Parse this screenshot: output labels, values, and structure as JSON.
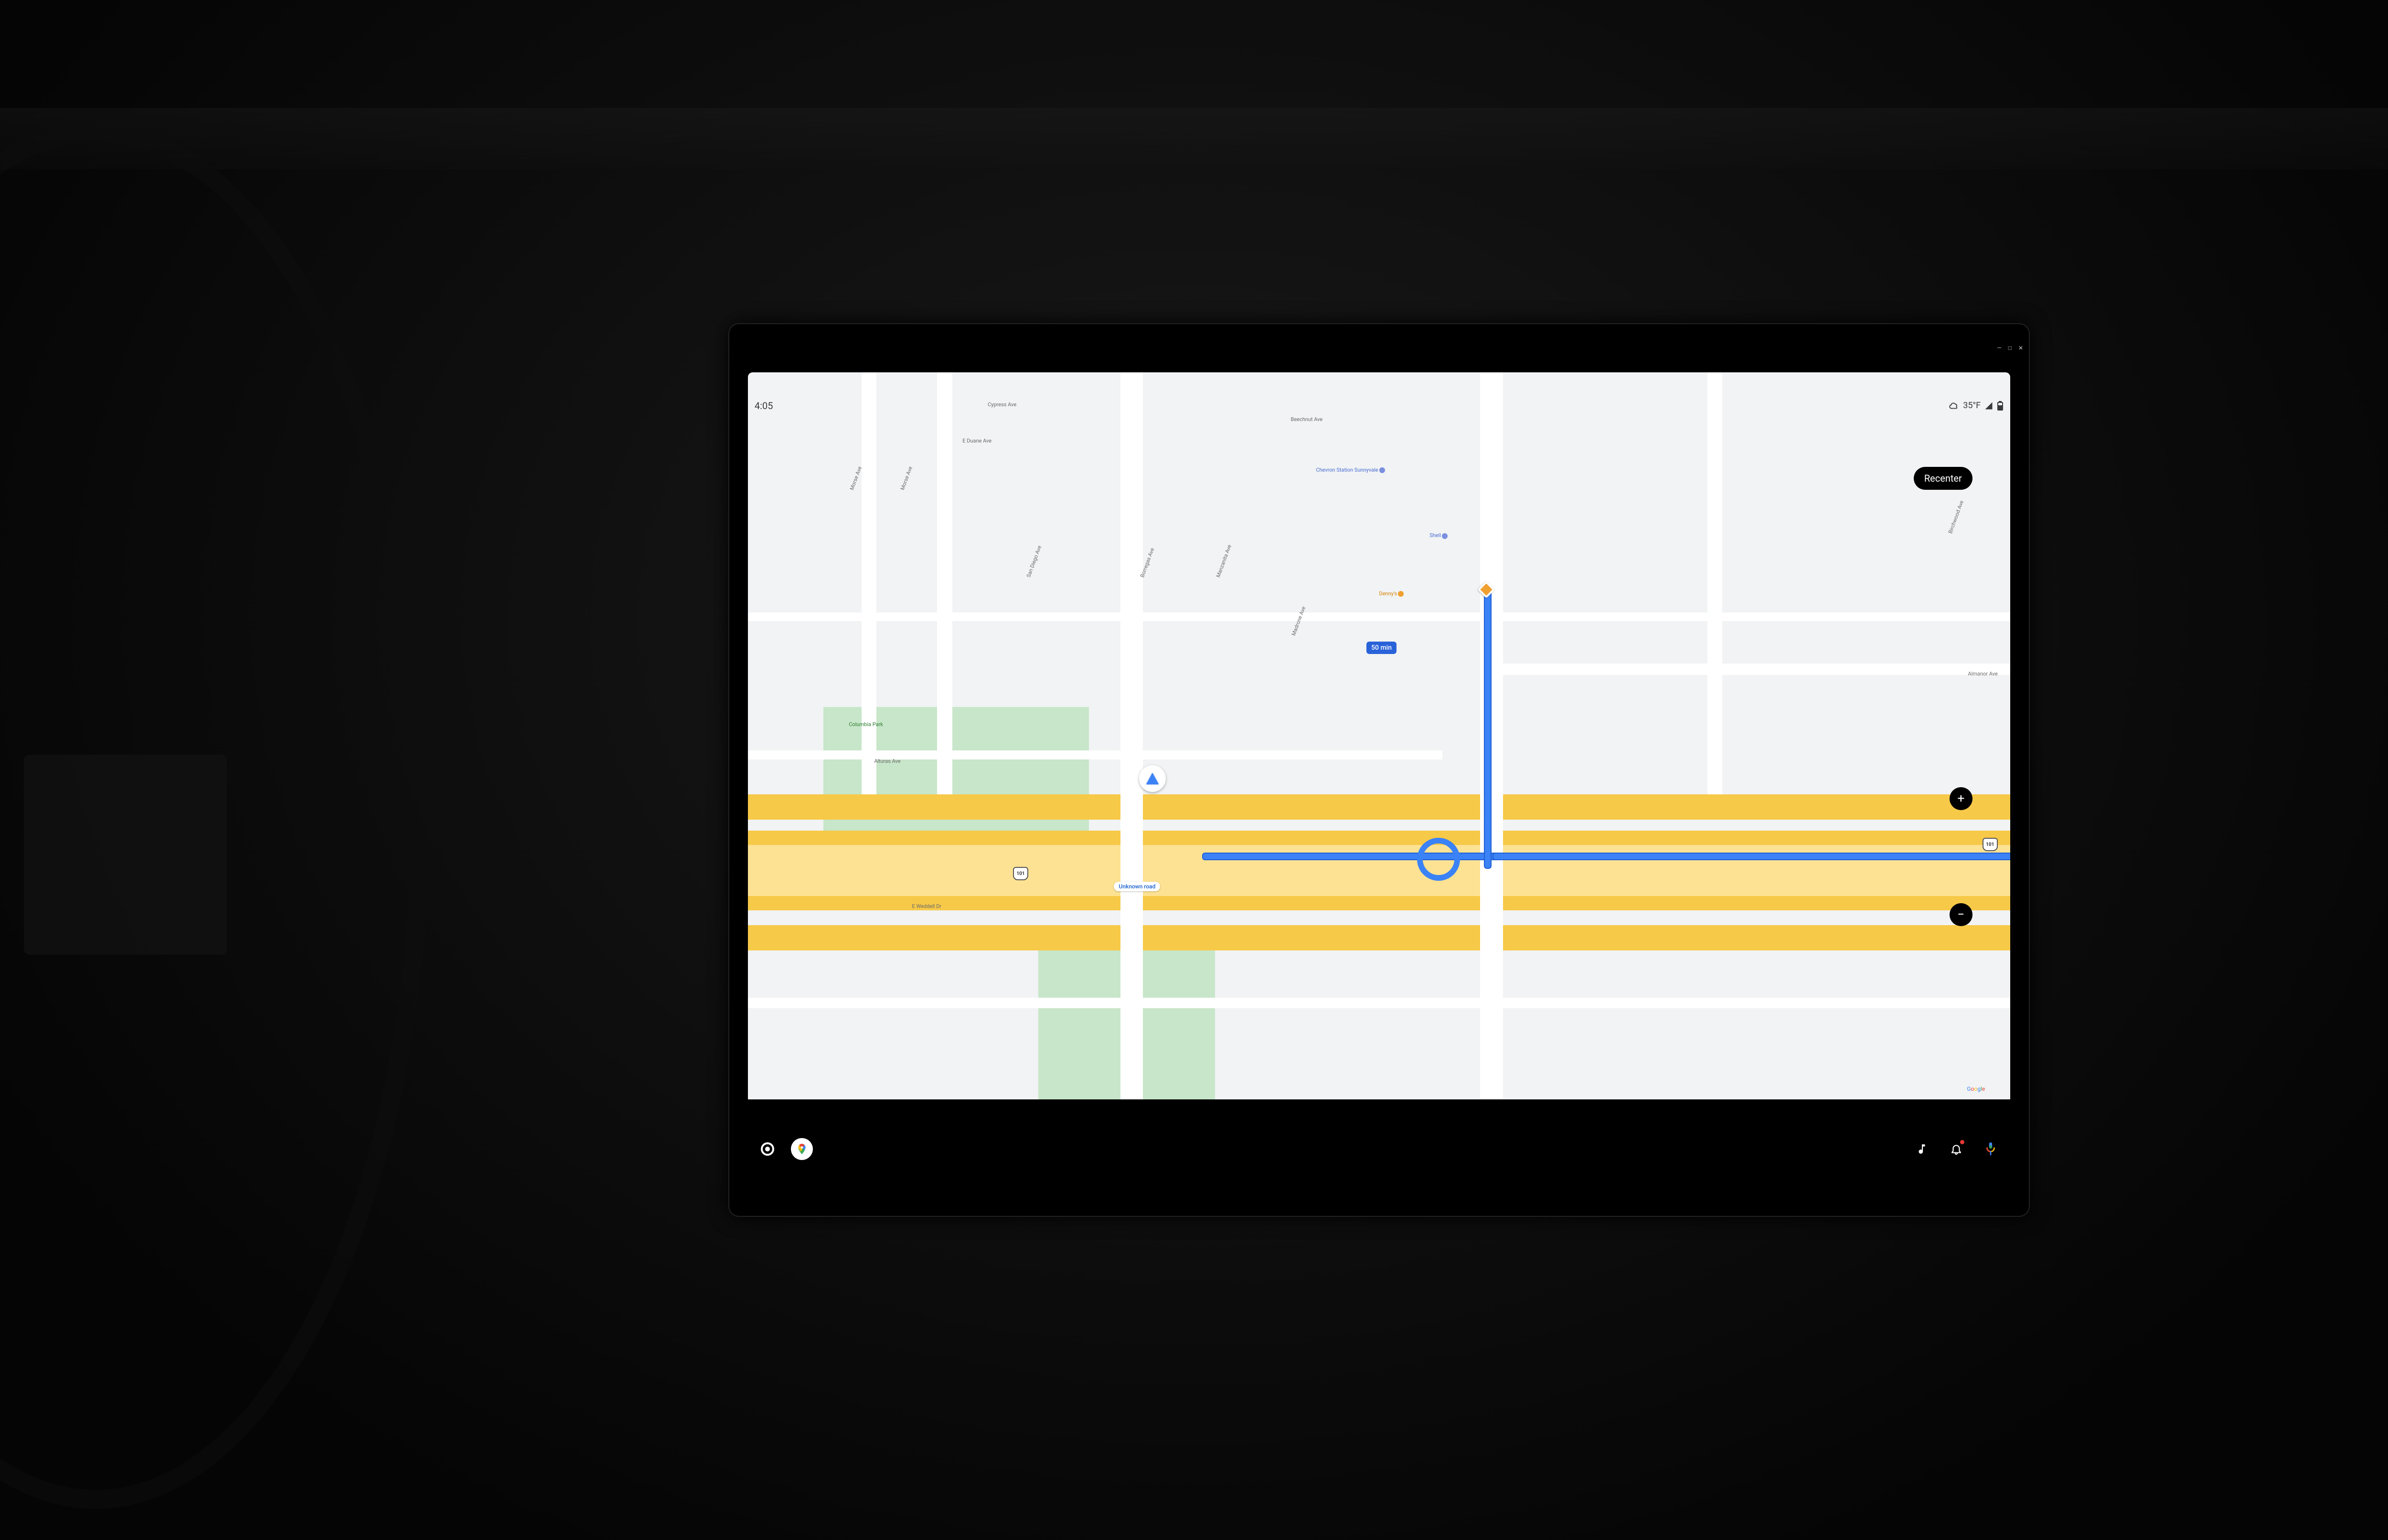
{
  "window_controls": {
    "minimize": "—",
    "maximize": "□",
    "close": "✕"
  },
  "status_bar": {
    "time": "4:05",
    "temperature": "35°F",
    "weather_icon": "cloud-icon",
    "signal_icon": "cell-signal-icon",
    "battery_icon": "battery-icon"
  },
  "map": {
    "recenter_label": "Recenter",
    "current_road_label": "Unknown road",
    "eta_badge": "50 min",
    "highway_shields": [
      "101",
      "101"
    ],
    "attribution": "Google",
    "street_labels": {
      "morse": "Morse Ave",
      "morse2": "Morse Ave",
      "cypress": "Cypress Ave",
      "eduane": "E Duane Ave",
      "sandiego": "San Diego Ave",
      "borregas": "Borregas Ave",
      "manzanita": "Manzanita Ave",
      "madrone": "Madrone Ave",
      "beechnut": "Beechnut Ave",
      "birchwood": "Birchwood Ave",
      "almanor": "Almanor Ave",
      "alturas": "Alturas Ave",
      "eweddell": "E Weddell Dr",
      "columbia": "Columbia Park"
    },
    "pois": {
      "chevron": "Chevron Station Sunnyvale",
      "shell": "Shell",
      "dennys": "Denny's"
    }
  },
  "navbar": {
    "launcher": "app-launcher",
    "maps": "google-maps",
    "music": "music",
    "notifications": "notifications",
    "assistant": "voice-assistant"
  }
}
